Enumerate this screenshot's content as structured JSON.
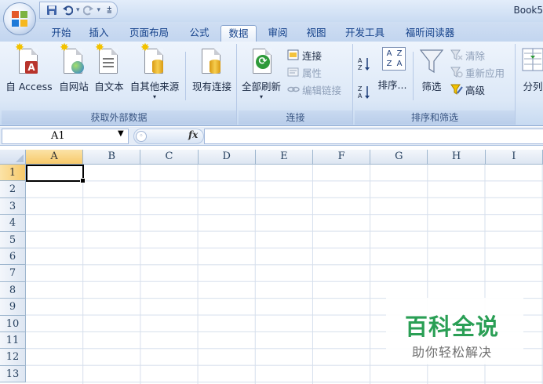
{
  "window": {
    "title": "Book5"
  },
  "qat": {
    "save_icon": "save-icon",
    "undo_icon": "undo-icon",
    "redo_icon": "redo-icon",
    "customize_glyph": "⩲"
  },
  "tabs": [
    {
      "label": "开始"
    },
    {
      "label": "插入"
    },
    {
      "label": "页面布局"
    },
    {
      "label": "公式"
    },
    {
      "label": "数据",
      "active": true
    },
    {
      "label": "审阅"
    },
    {
      "label": "视图"
    },
    {
      "label": "开发工具"
    },
    {
      "label": "福昕阅读器"
    }
  ],
  "ribbon": {
    "external": {
      "label": "获取外部数据",
      "access": "自 Access",
      "web": "自网站",
      "text": "自文本",
      "other": "自其他来源",
      "existing": "现有连接"
    },
    "connections": {
      "label": "连接",
      "refresh_all": "全部刷新",
      "connections": "连接",
      "properties": "属性",
      "edit_links": "编辑链接"
    },
    "sort_filter": {
      "label": "排序和筛选",
      "sort": "排序...",
      "filter": "筛选",
      "clear": "清除",
      "reapply": "重新应用",
      "advanced": "高级"
    },
    "tools": {
      "split": "分列"
    }
  },
  "formula_bar": {
    "name_box": "A1",
    "fx": "fx",
    "formula": ""
  },
  "grid": {
    "columns": [
      "A",
      "B",
      "C",
      "D",
      "E",
      "F",
      "G",
      "H",
      "I"
    ],
    "rows": [
      "1",
      "2",
      "3",
      "4",
      "5",
      "6",
      "7",
      "8",
      "9",
      "10",
      "11",
      "12",
      "13"
    ],
    "active_cell": "A1"
  },
  "watermark": {
    "title": "百科全说",
    "subtitle": "助你轻松解决"
  },
  "colors": {
    "accent": "#15428b",
    "ribbon": "#dce8f7",
    "selected_header": "#f7c96a",
    "watermark_green": "#2a9f55"
  }
}
